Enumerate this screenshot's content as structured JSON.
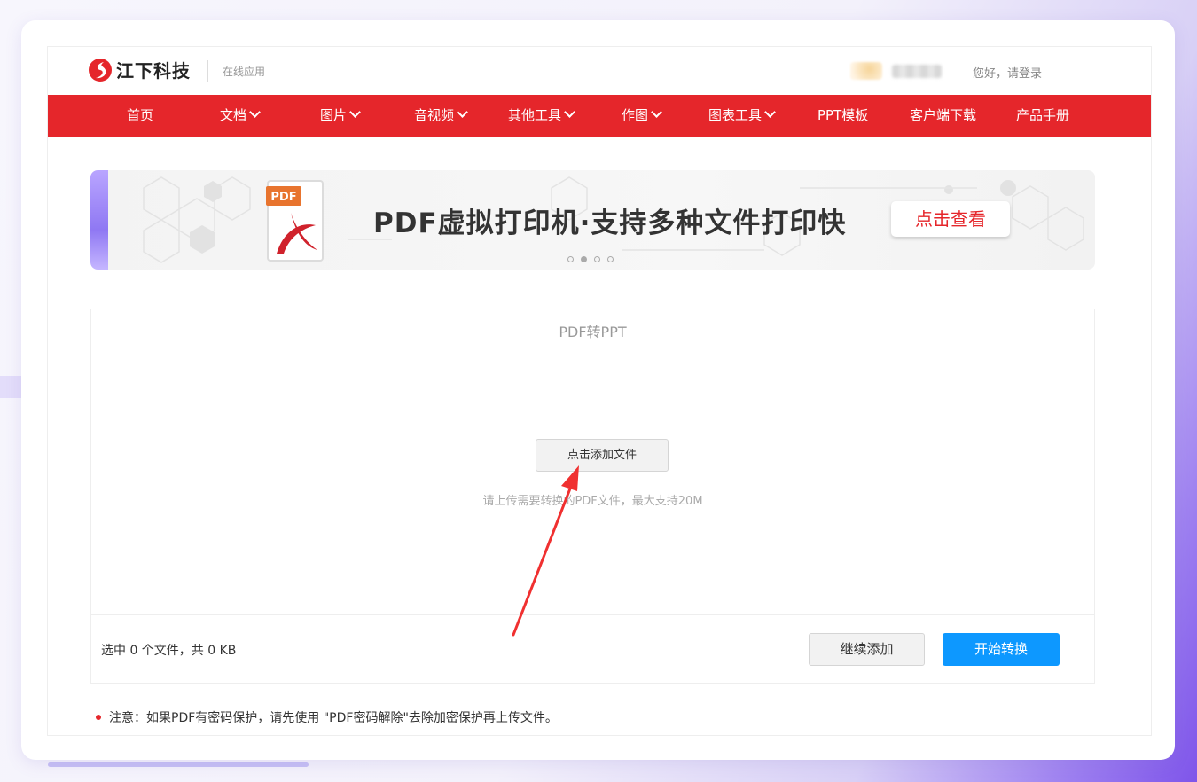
{
  "brand": {
    "name": "江下科技",
    "subtitle": "在线应用"
  },
  "header": {
    "login_text": "您好，请登录"
  },
  "nav": {
    "items": [
      {
        "label": "首页",
        "dropdown": false
      },
      {
        "label": "文档",
        "dropdown": true
      },
      {
        "label": "图片",
        "dropdown": true
      },
      {
        "label": "音视频",
        "dropdown": true
      },
      {
        "label": "其他工具",
        "dropdown": true
      },
      {
        "label": "作图",
        "dropdown": true
      },
      {
        "label": "图表工具",
        "dropdown": true
      },
      {
        "label": "PPT模板",
        "dropdown": false
      },
      {
        "label": "客户端下载",
        "dropdown": false
      },
      {
        "label": "产品手册",
        "dropdown": false
      }
    ]
  },
  "banner": {
    "title": "PDF虚拟打印机·支持多种文件打印快",
    "button": "点击查看",
    "icon_label": "PDF",
    "slides": 4,
    "active_slide": 2
  },
  "converter": {
    "title": "PDF转PPT",
    "add_button": "点击添加文件",
    "hint": "请上传需要转换的PDF文件，最大支持20M",
    "status": "选中 0 个文件，共 0 KB",
    "continue_button": "继续添加",
    "start_button": "开始转换"
  },
  "notice": "注意：如果PDF有密码保护，请先使用 \"PDF密码解除\"去除加密保护再上传文件。",
  "colors": {
    "brand_red": "#e5262b",
    "primary_blue": "#0d98ff"
  }
}
